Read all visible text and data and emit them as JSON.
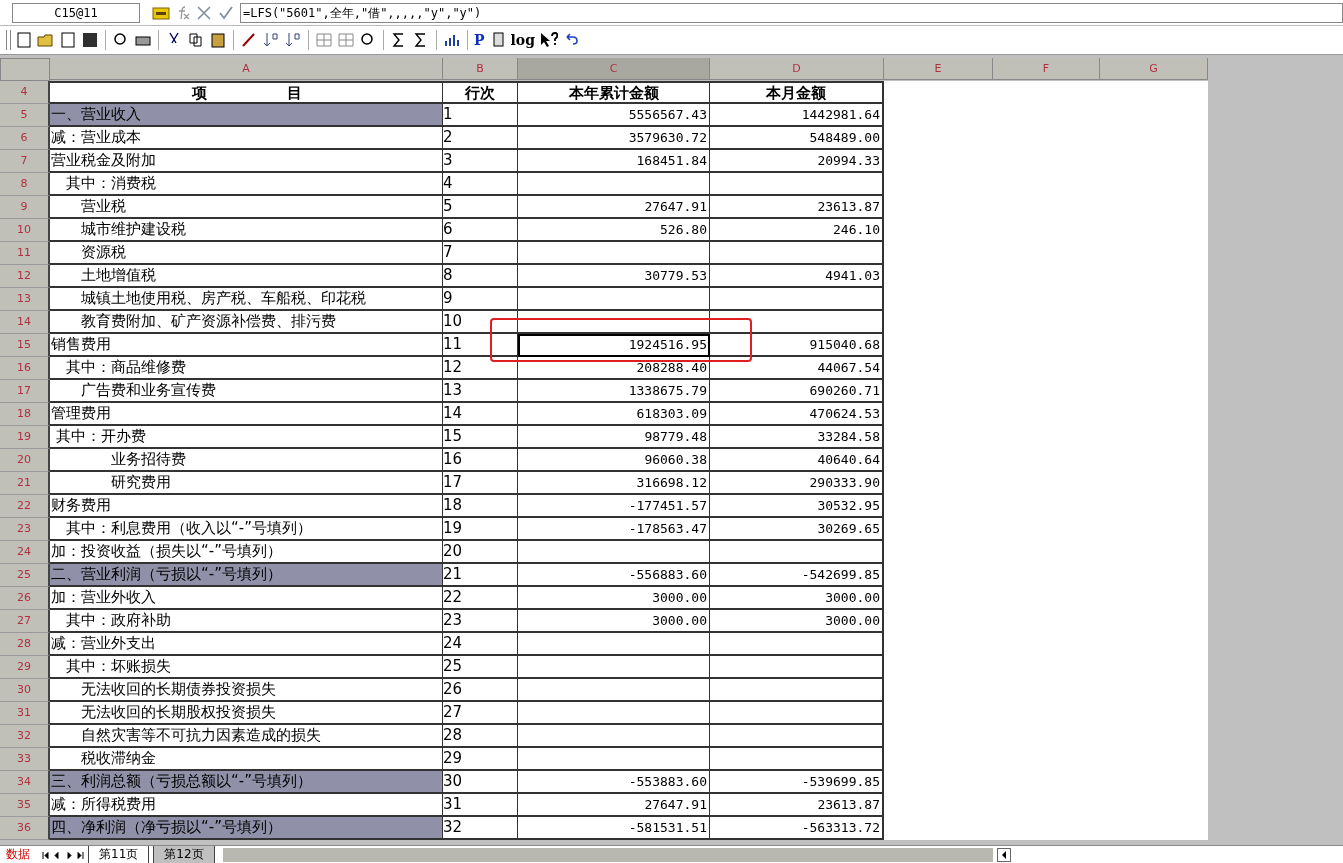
{
  "formula_bar": {
    "cell_ref": "C15@11",
    "formula": "=LFS(\"5601\",全年,\"借\",,,,,\"y\",\"y\")"
  },
  "toolbar": {
    "text_icons": [
      "P",
      "log"
    ]
  },
  "columns": [
    {
      "letter": "A",
      "selected": false
    },
    {
      "letter": "B",
      "selected": false
    },
    {
      "letter": "C",
      "selected": true
    },
    {
      "letter": "D",
      "selected": false
    },
    {
      "letter": "E",
      "selected": false
    },
    {
      "letter": "F",
      "selected": false
    },
    {
      "letter": "G",
      "selected": false
    }
  ],
  "header_row": {
    "row": "4",
    "item_parts": [
      "项",
      "目"
    ],
    "line": "行次",
    "ytd": "本年累计金额",
    "month": "本月金额"
  },
  "rows": [
    {
      "row": "5",
      "item": "一、营业收入",
      "line": "1",
      "ytd": "5556567.43",
      "month": "1442981.64",
      "highlighted": true,
      "selected": false
    },
    {
      "row": "6",
      "item": "减：营业成本",
      "line": "2",
      "ytd": "3579630.72",
      "month": "548489.00",
      "highlighted": false,
      "selected": false
    },
    {
      "row": "7",
      "item": "营业税金及附加",
      "line": "3",
      "ytd": "168451.84",
      "month": "20994.33",
      "highlighted": false,
      "selected": false
    },
    {
      "row": "8",
      "item": "　其中：消费税",
      "line": "4",
      "highlighted": false,
      "selected": false
    },
    {
      "row": "9",
      "item": "　　营业税",
      "line": "5",
      "ytd": "27647.91",
      "month": "23613.87",
      "highlighted": false,
      "selected": false
    },
    {
      "row": "10",
      "item": "　　城市维护建设税",
      "line": "6",
      "ytd": "526.80",
      "month": "246.10",
      "highlighted": false,
      "selected": false
    },
    {
      "row": "11",
      "item": "　　资源税",
      "line": "7",
      "highlighted": false,
      "selected": false
    },
    {
      "row": "12",
      "item": "　　土地增值税",
      "line": "8",
      "ytd": "30779.53",
      "month": "4941.03",
      "highlighted": false,
      "selected": false
    },
    {
      "row": "13",
      "item": "　　城镇土地使用税、房产税、车船税、印花税",
      "line": "9",
      "highlighted": false,
      "selected": false
    },
    {
      "row": "14",
      "item": "　　教育费附加、矿产资源补偿费、排污费",
      "line": "10",
      "highlighted": false,
      "selected": false
    },
    {
      "row": "15",
      "item": "销售费用",
      "line": "11",
      "ytd": "1924516.95",
      "month": "915040.68",
      "highlighted": false,
      "selected": true
    },
    {
      "row": "16",
      "item": "　其中：商品维修费",
      "line": "12",
      "ytd": "208288.40",
      "month": "44067.54",
      "highlighted": false,
      "selected": false
    },
    {
      "row": "17",
      "item": "　　广告费和业务宣传费",
      "line": "13",
      "ytd": "1338675.79",
      "month": "690260.71",
      "highlighted": false,
      "selected": false
    },
    {
      "row": "18",
      "item": "管理费用",
      "line": "14",
      "ytd": "618303.09",
      "month": "470624.53",
      "highlighted": false,
      "selected": false
    },
    {
      "row": "19",
      "item": " 其中：开办费",
      "line": "15",
      "ytd": "98779.48",
      "month": "33284.58",
      "highlighted": false,
      "selected": false
    },
    {
      "row": "20",
      "item": "　　　　业务招待费",
      "line": "16",
      "ytd": "96060.38",
      "month": "40640.64",
      "highlighted": false,
      "selected": false
    },
    {
      "row": "21",
      "item": "　　　　研究费用",
      "line": "17",
      "ytd": "316698.12",
      "month": "290333.90",
      "highlighted": false,
      "selected": false
    },
    {
      "row": "22",
      "item": "财务费用",
      "line": "18",
      "ytd": "-177451.57",
      "month": "30532.95",
      "highlighted": false,
      "selected": false
    },
    {
      "row": "23",
      "item": "　其中：利息费用（收入以“-”号填列）",
      "line": "19",
      "ytd": "-178563.47",
      "month": "30269.65",
      "highlighted": false,
      "selected": false
    },
    {
      "row": "24",
      "item": "加：投资收益（损失以“-”号填列）",
      "line": "20",
      "highlighted": false,
      "selected": false
    },
    {
      "row": "25",
      "item": "二、营业利润（亏损以“-”号填列）",
      "line": "21",
      "ytd": "-556883.60",
      "month": "-542699.85",
      "highlighted": true,
      "selected": false
    },
    {
      "row": "26",
      "item": "加：营业外收入",
      "line": "22",
      "ytd": "3000.00",
      "month": "3000.00",
      "highlighted": false,
      "selected": false
    },
    {
      "row": "27",
      "item": "　其中：政府补助",
      "line": "23",
      "ytd": "3000.00",
      "month": "3000.00",
      "highlighted": false,
      "selected": false
    },
    {
      "row": "28",
      "item": "减：营业外支出",
      "line": "24",
      "highlighted": false,
      "selected": false
    },
    {
      "row": "29",
      "item": "　其中：坏账损失",
      "line": "25",
      "highlighted": false,
      "selected": false
    },
    {
      "row": "30",
      "item": "　　无法收回的长期债券投资损失",
      "line": "26",
      "highlighted": false,
      "selected": false
    },
    {
      "row": "31",
      "item": "　　无法收回的长期股权投资损失",
      "line": "27",
      "highlighted": false,
      "selected": false
    },
    {
      "row": "32",
      "item": "　　自然灾害等不可抗力因素造成的损失",
      "line": "28",
      "highlighted": false,
      "selected": false
    },
    {
      "row": "33",
      "item": "　　税收滞纳金",
      "line": "29",
      "highlighted": false,
      "selected": false
    },
    {
      "row": "34",
      "item": "三、利润总额（亏损总额以“-”号填列）",
      "line": "30",
      "ytd": "-553883.60",
      "month": "-539699.85",
      "highlighted": true,
      "selected": false
    },
    {
      "row": "35",
      "item": "减：所得税费用",
      "line": "31",
      "ytd": "27647.91",
      "month": "23613.87",
      "highlighted": false,
      "selected": false
    },
    {
      "row": "36",
      "item": "四、净利润（净亏损以“-”号填列）",
      "line": "32",
      "ytd": "-581531.51",
      "month": "-563313.72",
      "highlighted": true,
      "selected": false
    }
  ],
  "sheet_bar": {
    "mode": "数据",
    "tabs": [
      {
        "label": "第11页",
        "selected": true
      },
      {
        "label": "第12页",
        "selected": false
      }
    ]
  }
}
